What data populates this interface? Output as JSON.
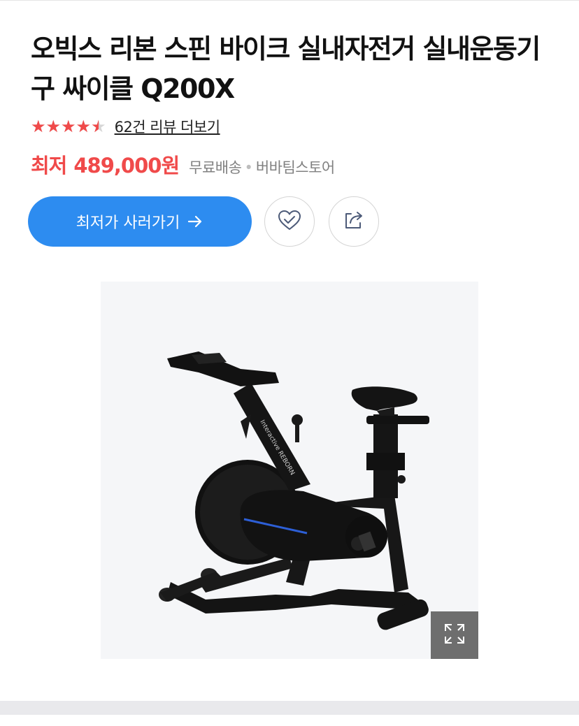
{
  "product": {
    "title": "오빅스 리본 스핀 바이크 실내자전거 실내운동기구 싸이클 Q200X"
  },
  "rating": {
    "stars": "★★★★★",
    "value_fraction": 0.9,
    "review_link": "62건 리뷰 더보기"
  },
  "price": {
    "label": "최저",
    "value": "489,000원",
    "shipping": "무료배송",
    "separator": "•",
    "store": "버바팀스토어"
  },
  "actions": {
    "buy_label": "최저가 사러가기",
    "wish_icon": "heart-check-icon",
    "share_icon": "share-icon"
  },
  "image": {
    "brand_text": "Interactive REBORN",
    "expand_icon": "expand-icon"
  },
  "colors": {
    "accent": "#2d8cf0",
    "price": "#f04a4a",
    "star": "#f04a4a"
  }
}
